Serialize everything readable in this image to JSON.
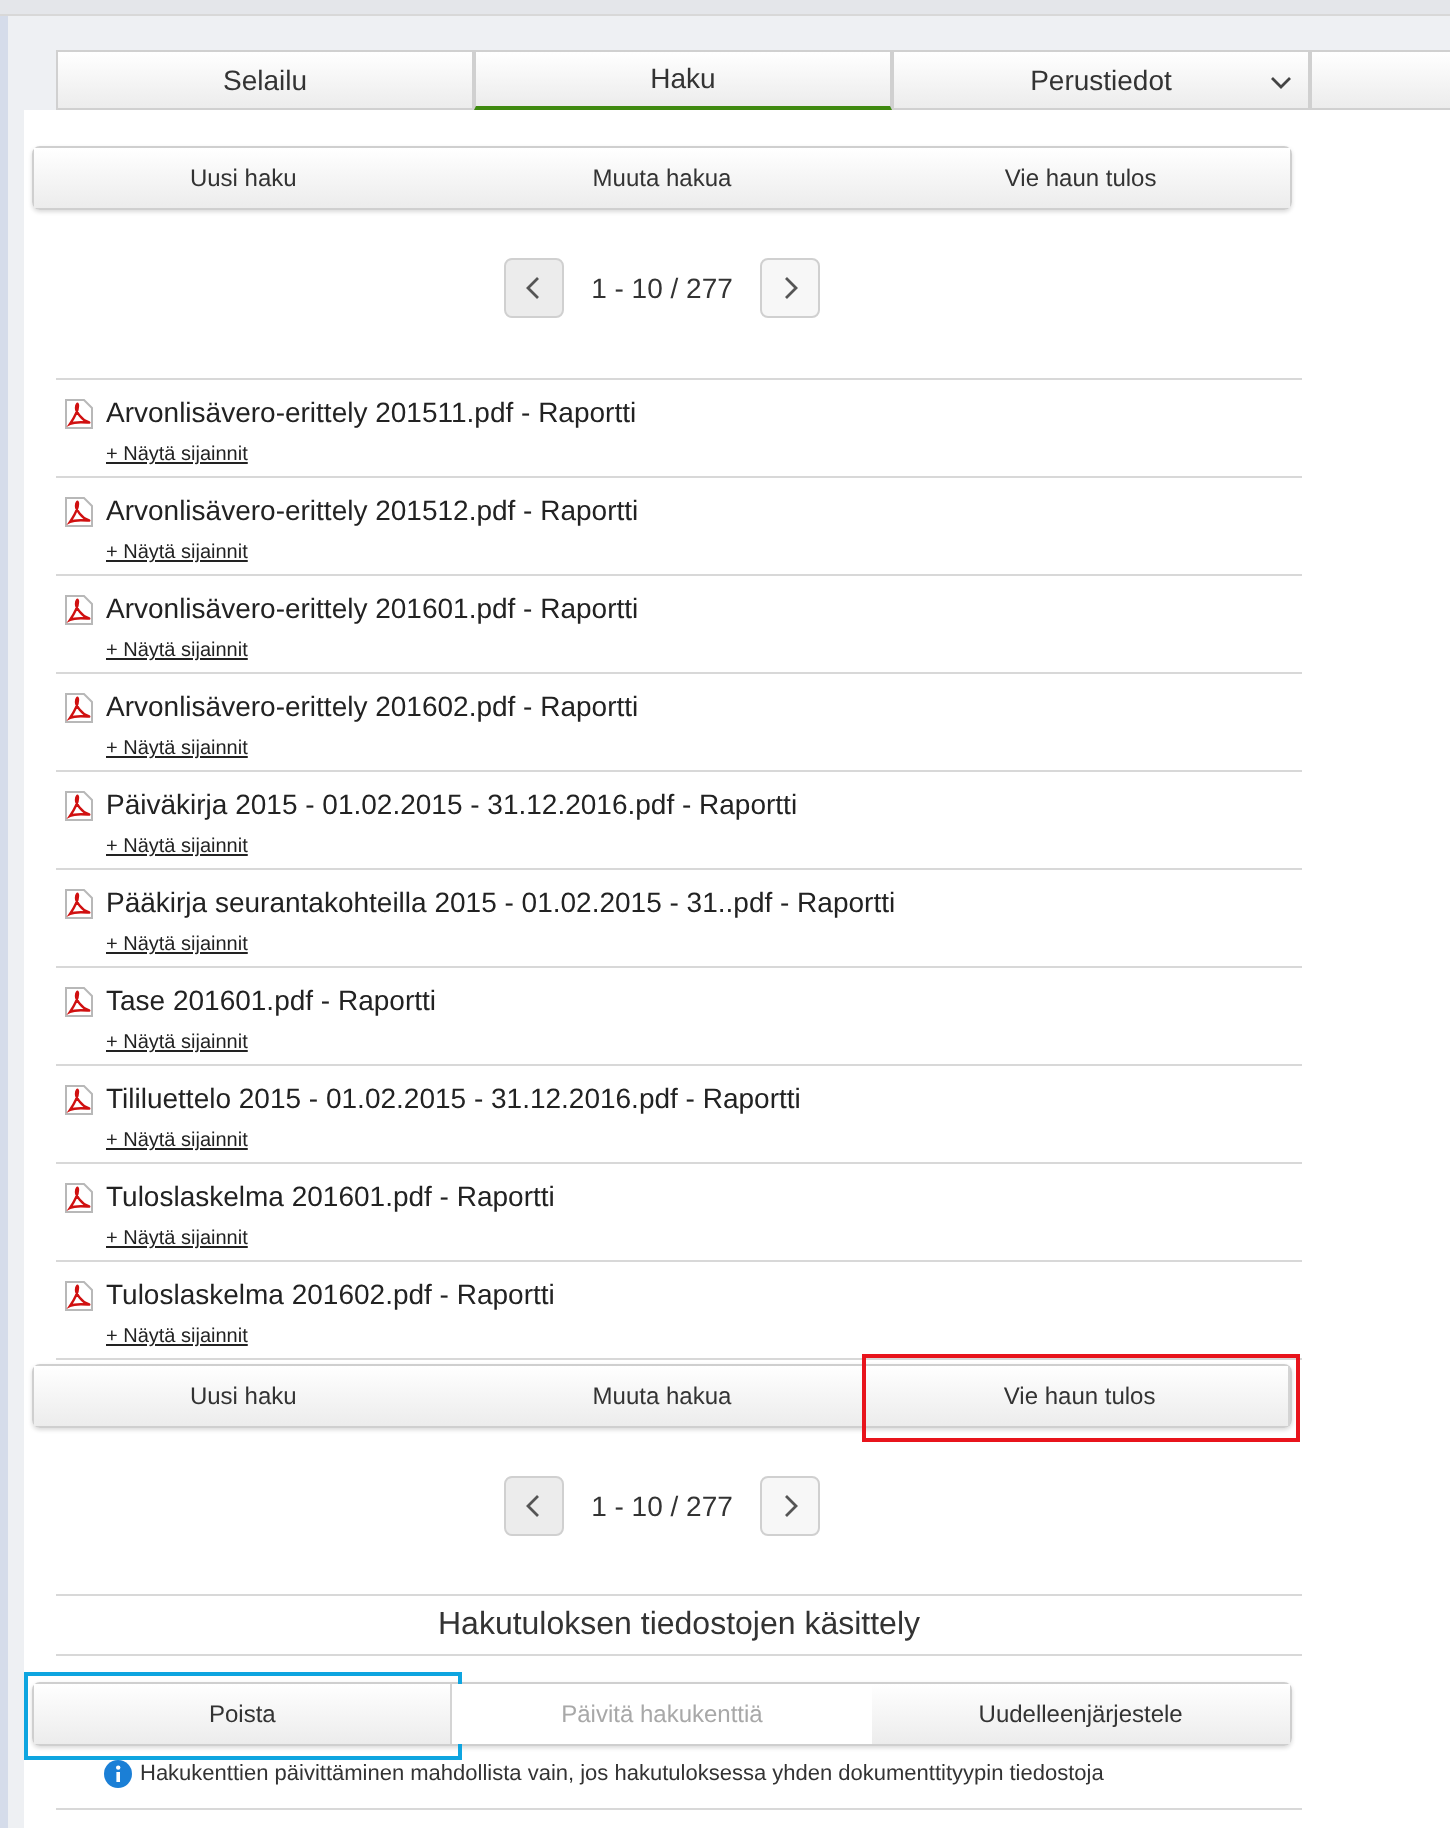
{
  "tabs": [
    {
      "label": "Selailu",
      "selected": false,
      "dropdown": false
    },
    {
      "label": "Haku",
      "selected": true,
      "dropdown": false
    },
    {
      "label": "Perustiedot",
      "selected": false,
      "dropdown": true
    }
  ],
  "top_actions": [
    {
      "label": "Uusi haku",
      "highlighted": false
    },
    {
      "label": "Muuta hakua",
      "highlighted": false
    },
    {
      "label": "Vie haun tulos",
      "highlighted": false
    }
  ],
  "top_pager": {
    "range": "1 - 10 / 277"
  },
  "results": [
    {
      "title": "Arvonlisävero-erittely 201511.pdf - Raportti",
      "link": "+ Näytä sijainnit"
    },
    {
      "title": "Arvonlisävero-erittely 201512.pdf - Raportti",
      "link": "+ Näytä sijainnit"
    },
    {
      "title": "Arvonlisävero-erittely 201601.pdf - Raportti",
      "link": "+ Näytä sijainnit"
    },
    {
      "title": "Arvonlisävero-erittely 201602.pdf - Raportti",
      "link": "+ Näytä sijainnit"
    },
    {
      "title": "Päiväkirja 2015 - 01.02.2015 - 31.12.2016.pdf - Raportti",
      "link": "+ Näytä sijainnit"
    },
    {
      "title": "Pääkirja seurantakohteilla 2015 - 01.02.2015 - 31..pdf - Raportti",
      "link": "+ Näytä sijainnit"
    },
    {
      "title": "Tase 201601.pdf - Raportti",
      "link": "+ Näytä sijainnit"
    },
    {
      "title": "Tililuettelo 2015 - 01.02.2015 - 31.12.2016.pdf - Raportti",
      "link": "+ Näytä sijainnit"
    },
    {
      "title": "Tuloslaskelma 201601.pdf - Raportti",
      "link": "+ Näytä sijainnit"
    },
    {
      "title": "Tuloslaskelma 201602.pdf - Raportti",
      "link": "+ Näytä sijainnit"
    }
  ],
  "bottom_actions": [
    {
      "label": "Uusi haku",
      "highlighted": false
    },
    {
      "label": "Muuta hakua",
      "highlighted": false
    },
    {
      "label": "Vie haun tulos",
      "highlighted": true,
      "color": "#e8141c"
    }
  ],
  "bottom_pager": {
    "range": "1 - 10 / 277"
  },
  "file_handling": {
    "heading": "Hakutuloksen tiedostojen käsittely",
    "actions": [
      {
        "label": "Poista",
        "disabled": false,
        "highlighted": true,
        "color": "#0ea5e0"
      },
      {
        "label": "Päivitä hakukenttiä",
        "disabled": true,
        "highlighted": false
      },
      {
        "label": "Uudelleenjärjestele",
        "disabled": false,
        "highlighted": false
      }
    ],
    "info": "Hakukenttien päivittäminen mahdollista vain, jos hakutuloksessa yhden dokumenttityypin tiedostoja"
  }
}
